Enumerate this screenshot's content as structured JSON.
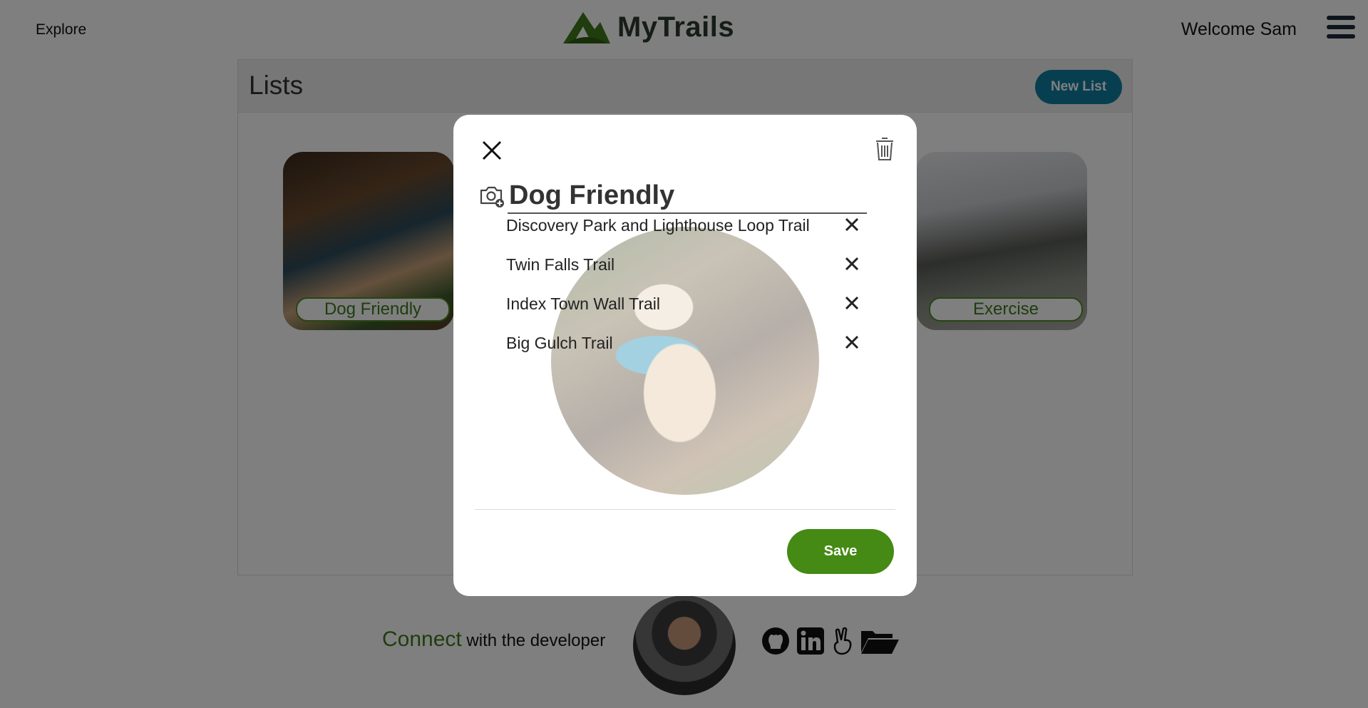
{
  "header": {
    "explore_label": "Explore",
    "brand_name": "MyTrails",
    "welcome_text": "Welcome Sam"
  },
  "lists_page": {
    "title": "Lists",
    "new_list_label": "New List",
    "cards": [
      {
        "label": "Dog Friendly"
      },
      {
        "label": "Exercise"
      }
    ]
  },
  "footer": {
    "connect_word": "Connect",
    "connect_rest": "with the developer"
  },
  "modal": {
    "list_title_value": "Dog Friendly",
    "trails": [
      {
        "name": "Discovery Park and Lighthouse Loop Trail"
      },
      {
        "name": "Twin Falls Trail"
      },
      {
        "name": "Index Town Wall Trail"
      },
      {
        "name": "Big Gulch Trail"
      }
    ],
    "save_label": "Save"
  },
  "icons": {
    "close": "close-icon",
    "trash": "trash-icon",
    "camera": "camera-add-icon",
    "remove": "remove-x-icon",
    "menu": "hamburger-menu-icon",
    "logo": "mountain-logo-icon",
    "social": [
      "github-icon",
      "linkedin-icon",
      "angellist-icon",
      "folder-open-icon"
    ]
  },
  "colors": {
    "brand_green": "#448a14",
    "teal_button": "#0f7ea0",
    "overlay": "rgba(0,0,0,0.5)"
  }
}
